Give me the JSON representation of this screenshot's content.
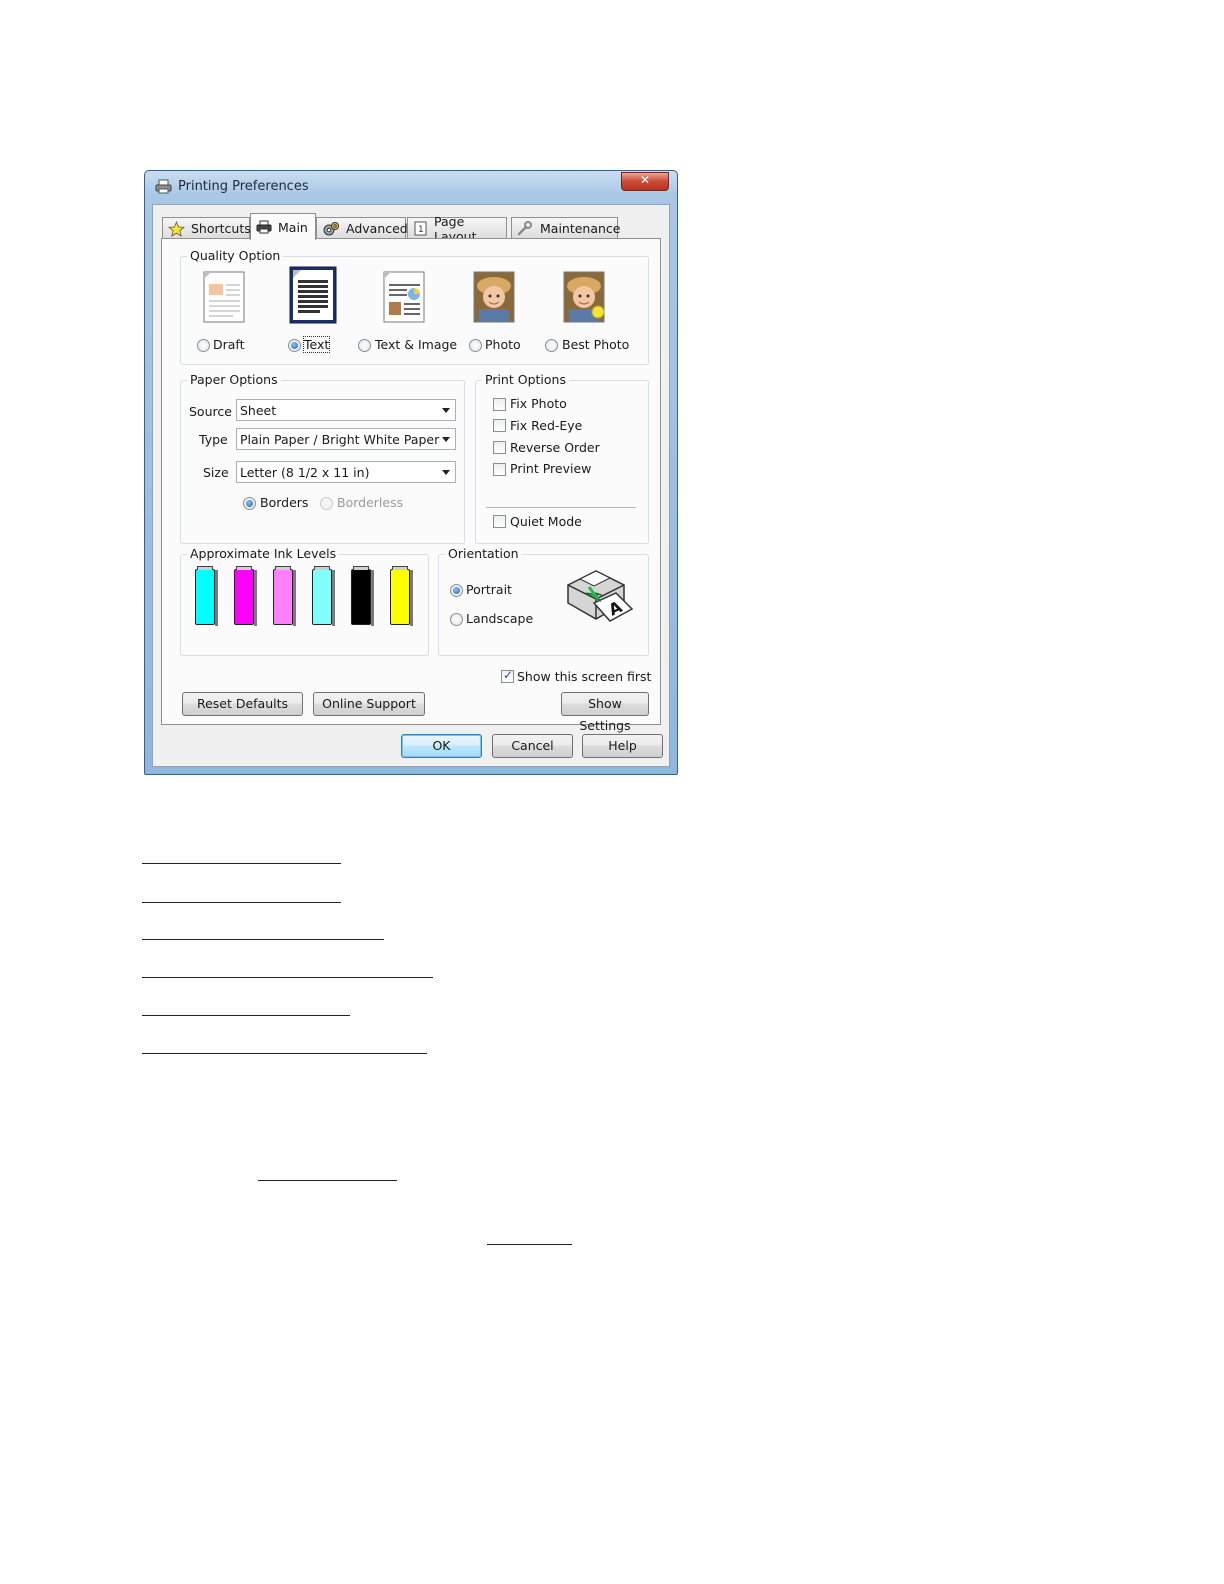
{
  "window": {
    "title": "Printing Preferences"
  },
  "tabs": [
    {
      "label": "Shortcuts",
      "icon": "star-icon"
    },
    {
      "label": "Main",
      "icon": "printer-icon"
    },
    {
      "label": "Advanced",
      "icon": "gears-icon"
    },
    {
      "label": "Page Layout",
      "icon": "page-icon"
    },
    {
      "label": "Maintenance",
      "icon": "wrench-icon"
    }
  ],
  "active_tab": "Main",
  "quality": {
    "label": "Quality Option",
    "options": [
      {
        "label": "Draft",
        "selected": false
      },
      {
        "label": "Text",
        "selected": true
      },
      {
        "label": "Text & Image",
        "selected": false
      },
      {
        "label": "Photo",
        "selected": false
      },
      {
        "label": "Best Photo",
        "selected": false
      }
    ]
  },
  "paper": {
    "label": "Paper Options",
    "source_label": "Source",
    "source_value": "Sheet",
    "type_label": "Type",
    "type_value": "Plain Paper / Bright White Paper",
    "size_label": "Size",
    "size_value": "Letter (8 1/2 x 11 in)",
    "borders_label": "Borders",
    "borders_selected": true,
    "borderless_label": "Borderless",
    "borderless_enabled": false
  },
  "print_options": {
    "label": "Print Options",
    "items": [
      {
        "label": "Fix Photo",
        "checked": false
      },
      {
        "label": "Fix Red-Eye",
        "checked": false
      },
      {
        "label": "Reverse Order",
        "checked": false
      },
      {
        "label": "Print Preview",
        "checked": false
      }
    ],
    "quiet_mode": {
      "label": "Quiet Mode",
      "checked": false
    }
  },
  "ink": {
    "label": "Approximate Ink Levels",
    "colors": [
      "#00ffff",
      "#ff00ff",
      "#ff80ff",
      "#80ffff",
      "#000000",
      "#ffff00"
    ]
  },
  "orientation": {
    "label": "Orientation",
    "portrait_label": "Portrait",
    "portrait_selected": true,
    "landscape_label": "Landscape"
  },
  "show_screen_first": {
    "label": "Show this screen first",
    "checked": true
  },
  "buttons": {
    "reset": "Reset Defaults",
    "online": "Online Support",
    "show_settings": "Show Settings",
    "ok": "OK",
    "cancel": "Cancel",
    "help": "Help"
  }
}
